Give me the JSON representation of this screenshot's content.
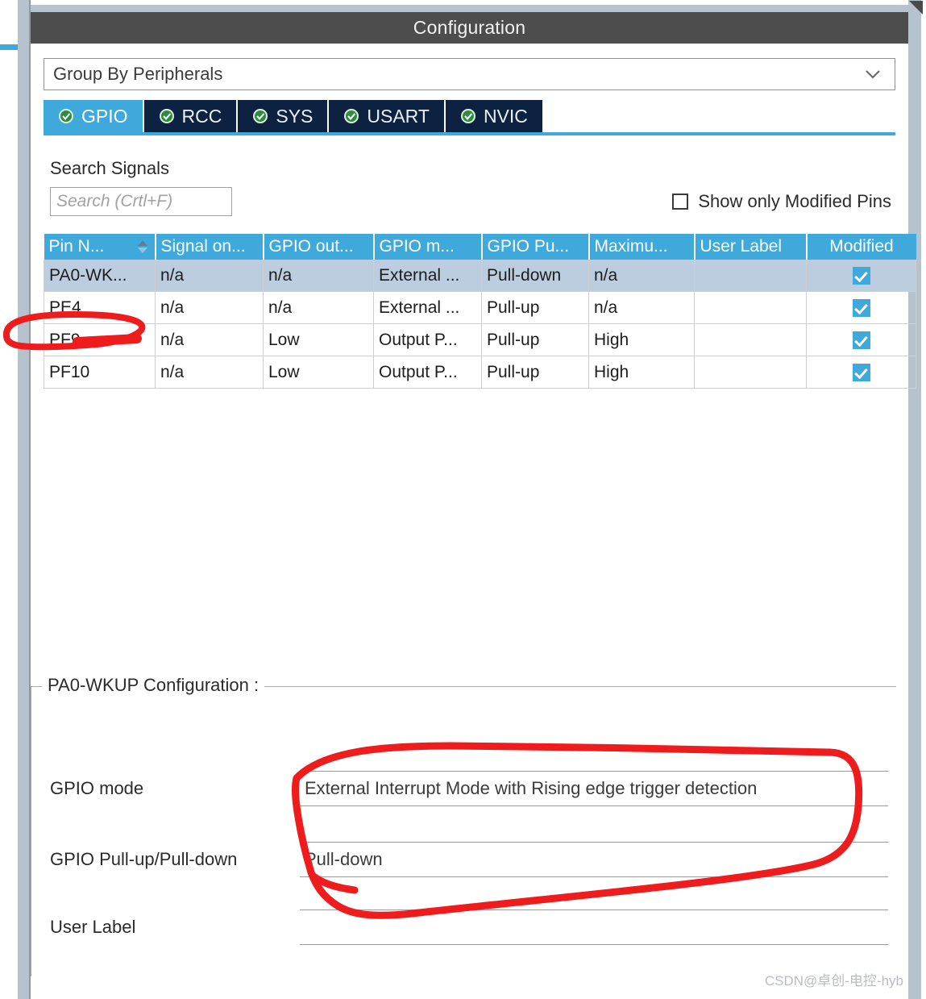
{
  "window": {
    "title": "Configuration"
  },
  "group_by": {
    "value": "Group By Peripherals",
    "chevron": "chevron-down-icon"
  },
  "tabs": [
    {
      "label": "GPIO",
      "active": true,
      "status_icon": "check-circle-icon"
    },
    {
      "label": "RCC",
      "active": false,
      "status_icon": "check-circle-icon"
    },
    {
      "label": "SYS",
      "active": false,
      "status_icon": "check-circle-icon"
    },
    {
      "label": "USART",
      "active": false,
      "status_icon": "check-circle-icon"
    },
    {
      "label": "NVIC",
      "active": false,
      "status_icon": "check-circle-icon"
    }
  ],
  "search": {
    "label": "Search Signals",
    "placeholder": "Search (Crtl+F)",
    "value": ""
  },
  "filter": {
    "modified_only_label": "Show only Modified Pins",
    "modified_only_checked": false
  },
  "pin_table": {
    "headers": [
      "Pin N...",
      "Signal on...",
      "GPIO out...",
      "GPIO m...",
      "GPIO Pu...",
      "Maximu...",
      "User Label",
      "Modified"
    ],
    "sort_column": "Pin N...",
    "sort_direction": "ascending",
    "rows": [
      {
        "selected": true,
        "pin": "PA0-WK...",
        "signal_on": "n/a",
        "gpio_output": "n/a",
        "gpio_mode": "External ...",
        "gpio_pull": "Pull-down",
        "maximum": "n/a",
        "user_label": "",
        "modified": true
      },
      {
        "selected": false,
        "pin": "PE4",
        "signal_on": "n/a",
        "gpio_output": "n/a",
        "gpio_mode": "External ...",
        "gpio_pull": "Pull-up",
        "maximum": "n/a",
        "user_label": "",
        "modified": true
      },
      {
        "selected": false,
        "pin": "PF9",
        "signal_on": "n/a",
        "gpio_output": "Low",
        "gpio_mode": "Output P...",
        "gpio_pull": "Pull-up",
        "maximum": "High",
        "user_label": "",
        "modified": true
      },
      {
        "selected": false,
        "pin": "PF10",
        "signal_on": "n/a",
        "gpio_output": "Low",
        "gpio_mode": "Output P...",
        "gpio_pull": "Pull-up",
        "maximum": "High",
        "user_label": "",
        "modified": true
      }
    ]
  },
  "pin_config": {
    "legend": "PA0-WKUP Configuration :",
    "fields": [
      {
        "label": "GPIO mode",
        "value": "External Interrupt Mode with Rising edge trigger detection"
      },
      {
        "label": "GPIO Pull-up/Pull-down",
        "value": "Pull-down"
      },
      {
        "label": "User Label",
        "value": ""
      }
    ]
  },
  "watermark": {
    "text": "CSDN@卓创-电控-hyb"
  },
  "colors": {
    "accent_blue": "#3fa9dc",
    "tab_inactive": "#0d2240",
    "titlebar": "#4d4d4d",
    "row_selected": "#bdcde0",
    "annotation_red": "#ee1c1c"
  }
}
